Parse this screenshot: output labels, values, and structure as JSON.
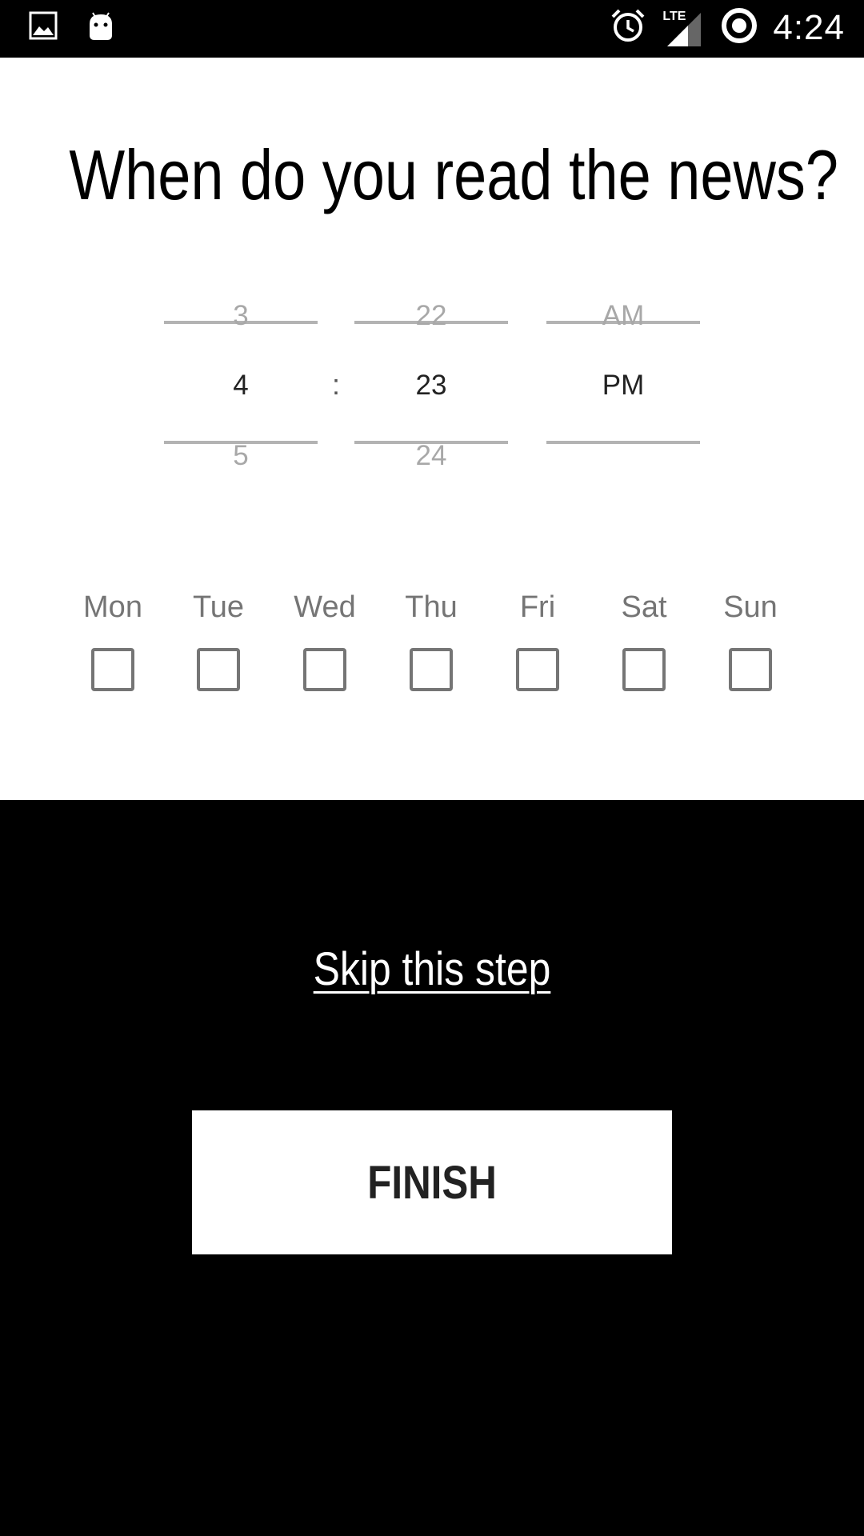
{
  "status_bar": {
    "time": "4:24",
    "network": "LTE",
    "left_icons": [
      "image-icon",
      "android-icon"
    ],
    "right_icons": [
      "alarm-icon",
      "signal-icon",
      "sync-icon"
    ]
  },
  "question": "When do you read the news?",
  "time_picker": {
    "hour": {
      "prev": "3",
      "current": "4",
      "next": "5"
    },
    "separator": ":",
    "minute": {
      "prev": "22",
      "current": "23",
      "next": "24"
    },
    "period": {
      "prev": "AM",
      "current": "PM",
      "next": ""
    }
  },
  "days": [
    {
      "label": "Mon",
      "checked": false
    },
    {
      "label": "Tue",
      "checked": false
    },
    {
      "label": "Wed",
      "checked": false
    },
    {
      "label": "Thu",
      "checked": false
    },
    {
      "label": "Fri",
      "checked": false
    },
    {
      "label": "Sat",
      "checked": false
    },
    {
      "label": "Sun",
      "checked": false
    }
  ],
  "skip_label": "Skip this step",
  "finish_label": "FINISH"
}
